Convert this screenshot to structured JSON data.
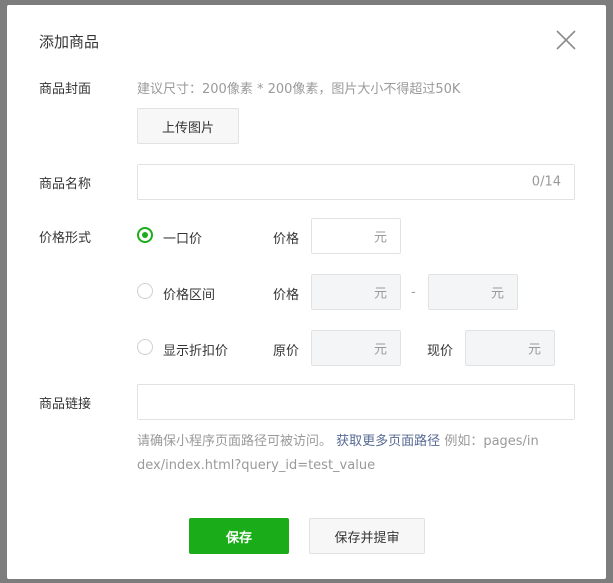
{
  "dialog": {
    "title": "添加商品",
    "close_icon": "close-icon"
  },
  "cover": {
    "label": "商品封面",
    "hint": "建议尺寸：200像素 * 200像素，图片大小不得超过50K",
    "upload_label": "上传图片"
  },
  "name": {
    "label": "商品名称",
    "value": "",
    "counter": "0/14"
  },
  "price": {
    "label": "价格形式",
    "options": [
      {
        "label": "一口价",
        "checked": true,
        "fields": [
          {
            "label": "价格",
            "suffix": "元"
          }
        ]
      },
      {
        "label": "价格区间",
        "checked": false,
        "fields": [
          {
            "label": "价格",
            "suffix": "元"
          },
          {
            "suffix": "元"
          }
        ],
        "separator": "-"
      },
      {
        "label": "显示折扣价",
        "checked": false,
        "fields": [
          {
            "label": "原价",
            "suffix": "元"
          },
          {
            "label": "现价",
            "suffix": "元"
          }
        ]
      }
    ]
  },
  "link": {
    "label": "商品链接",
    "value": "",
    "note_prefix": "请确保小程序页面路径可被访问。",
    "note_link": "获取更多页面路径",
    "note_example_1": "例如：pages/in",
    "note_example_2": "dex/index.html?query_id=test_value"
  },
  "footer": {
    "save_label": "保存",
    "save_submit_label": "保存并提审"
  },
  "colors": {
    "accent": "#1aad19",
    "link": "#576b95"
  }
}
